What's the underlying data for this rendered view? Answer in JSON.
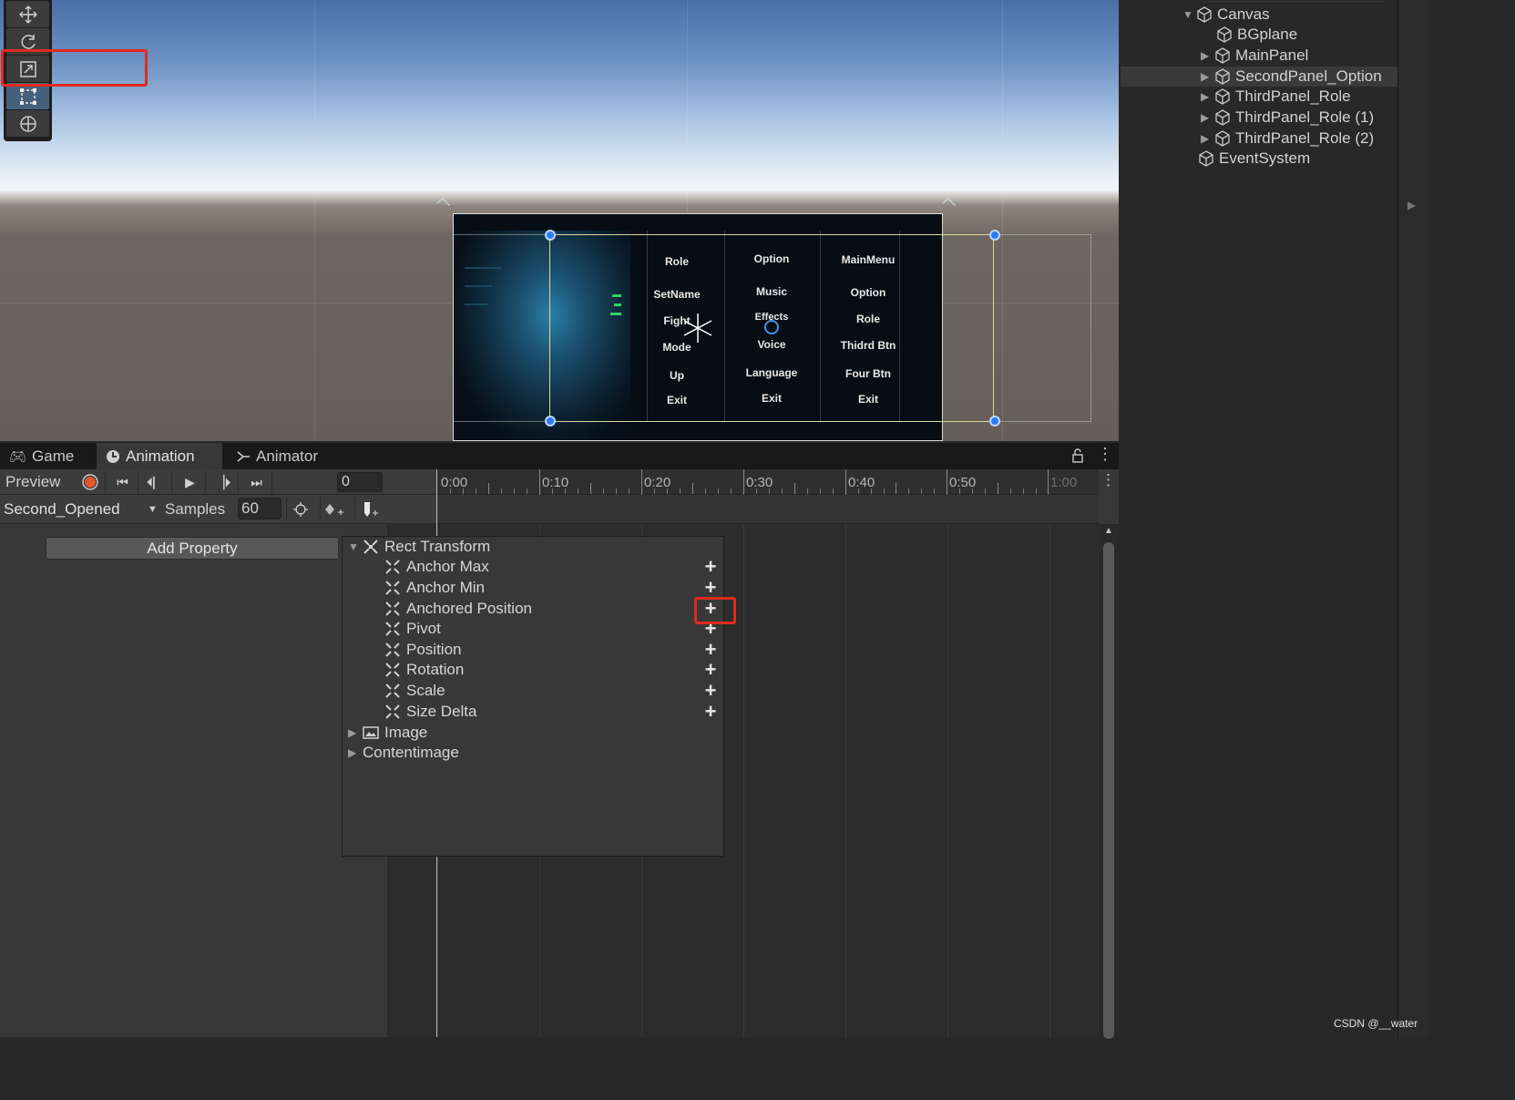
{
  "scene": {
    "tools": [
      {
        "icon": "move-tool-icon",
        "active": false
      },
      {
        "icon": "rotate-tool-icon",
        "active": false
      },
      {
        "icon": "scale-tool-icon",
        "active": false
      },
      {
        "icon": "rect-tool-icon",
        "active": true
      },
      {
        "icon": "transform-tool-icon",
        "active": false
      }
    ],
    "game_panel": {
      "column1": [
        "Role",
        "SetName",
        "Fight",
        "Mode",
        "Up",
        "Exit"
      ],
      "column2": [
        "Option",
        "Music",
        "Effects",
        "Voice",
        "Language",
        "Exit"
      ],
      "column3": [
        "MainMenu",
        "Option",
        "Role",
        "Thidrd Btn",
        "Four Btn",
        "Exit"
      ]
    }
  },
  "hierarchy": {
    "items": [
      {
        "label": "Canvas",
        "expanded": true,
        "has_children": true,
        "selected": false
      },
      {
        "label": "BGplane",
        "has_children": false,
        "selected": false
      },
      {
        "label": "MainPanel",
        "has_children": true,
        "selected": false
      },
      {
        "label": "SecondPanel_Option",
        "has_children": true,
        "selected": true
      },
      {
        "label": "ThirdPanel_Role",
        "has_children": true,
        "selected": false
      },
      {
        "label": "ThirdPanel_Role (1)",
        "has_children": true,
        "selected": false
      },
      {
        "label": "ThirdPanel_Role (2)",
        "has_children": true,
        "selected": false
      },
      {
        "label": "EventSystem",
        "has_children": false,
        "selected": false
      }
    ]
  },
  "tabs": [
    {
      "label": "Game",
      "icon": "gamepad-icon",
      "active": false
    },
    {
      "label": "Animation",
      "icon": "clock-icon",
      "active": true
    },
    {
      "label": "Animator",
      "icon": "animator-icon",
      "active": false
    }
  ],
  "animation": {
    "preview_label": "Preview",
    "frame_value": "0",
    "clip_name": "Second_Opened",
    "samples_label": "Samples",
    "samples_value": "60",
    "add_property_label": "Add Property",
    "timeline_labels": [
      "0:00",
      "0:10",
      "0:20",
      "0:30",
      "0:40",
      "0:50",
      "1:00"
    ]
  },
  "property_dropdown": {
    "group": "Rect Transform",
    "properties": [
      "Anchor Max",
      "Anchor Min",
      "Anchored Position",
      "Pivot",
      "Position",
      "Rotation",
      "Scale",
      "Size Delta"
    ],
    "other_components": [
      {
        "label": "Image",
        "icon": "image-icon"
      },
      {
        "label": "Contentimage",
        "icon": ""
      }
    ],
    "highlighted_property": "Anchored Position"
  },
  "watermark": "CSDN @__water",
  "colors": {
    "highlight_red": "#e02a1f",
    "selection_blue": "#2d7cf0",
    "record_red": "#e2582a"
  }
}
